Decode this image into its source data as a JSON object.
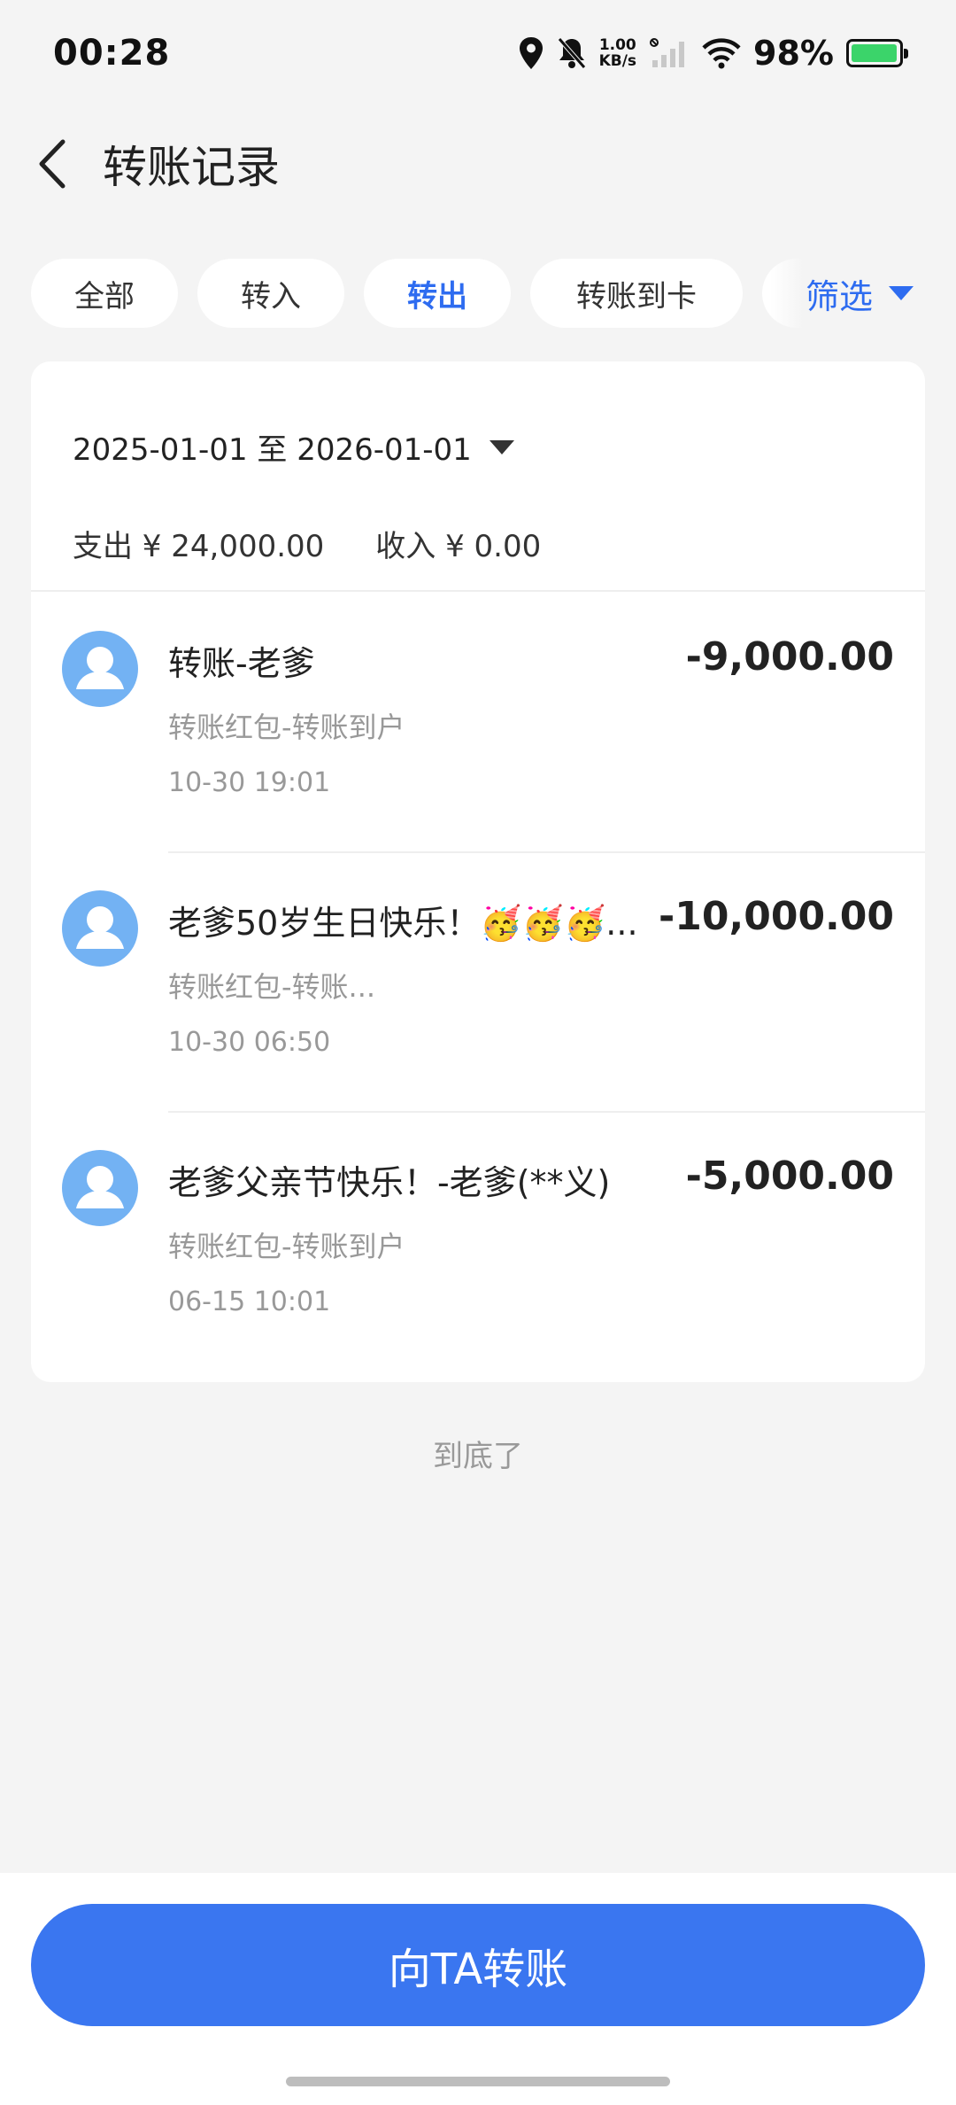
{
  "status": {
    "time": "00:28",
    "speed_top": "1.00",
    "speed_bottom": "KB/s",
    "battery": "98%",
    "battery_level": 0.98,
    "icons": [
      "location-icon",
      "mute-bell-icon",
      "no-sim-icon",
      "signal-icon",
      "wifi-icon",
      "battery-icon"
    ]
  },
  "header": {
    "title": "转账记录"
  },
  "tabs": [
    {
      "label": "全部"
    },
    {
      "label": "转入"
    },
    {
      "label": "转出",
      "active": true
    },
    {
      "label": "转账到卡"
    }
  ],
  "filter": {
    "label": "筛选"
  },
  "summary": {
    "date_range": "2025-01-01 至 2026-01-01",
    "expense": "支出 ¥ 24,000.00",
    "income": "收入 ¥ 0.00"
  },
  "records": [
    {
      "title": "转账-老爹",
      "subtitle": "转账红包-转账到户",
      "time": "10-30 19:01",
      "amount": "-9,000.00"
    },
    {
      "title": "老爹50岁生日快乐！🥳🥳🥳...",
      "subtitle": "转账红包-转账...",
      "time": "10-30 06:50",
      "amount": "-10,000.00"
    },
    {
      "title": "老爹父亲节快乐！-老爹(**义)",
      "subtitle": "转账红包-转账到户",
      "time": "06-15 10:01",
      "amount": "-5,000.00"
    }
  ],
  "end_note": "到底了",
  "bottom": {
    "button_label": "向TA转账"
  },
  "colors": {
    "accent": "#2e6cf0",
    "button": "#3a76f0",
    "avatar": "#73b2f3",
    "background": "#f4f4f4"
  }
}
